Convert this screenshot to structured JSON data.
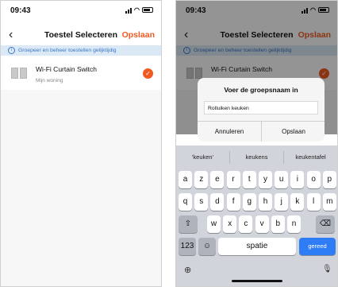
{
  "status": {
    "time": "09:43"
  },
  "nav": {
    "back_icon": "‹",
    "title": "Toestel Selecteren",
    "save_label": "Opslaan"
  },
  "info_banner": {
    "icon": "info-icon",
    "text": "Groepeer en beheer toestellen gelijktijdig"
  },
  "device": {
    "name": "Wi-Fi Curtain Switch",
    "location": "Mijn woning",
    "selected": true,
    "check": "✓"
  },
  "dialog": {
    "title": "Voer de groepsnaam in",
    "input_value": "Rolluiken keuken",
    "cancel_label": "Annuleren",
    "save_label": "Opslaan"
  },
  "keyboard": {
    "suggestions": [
      "'keuken'",
      "keukens",
      "keukentafel"
    ],
    "row1": [
      "a",
      "z",
      "e",
      "r",
      "t",
      "y",
      "u",
      "i",
      "o",
      "p"
    ],
    "row2": [
      "q",
      "s",
      "d",
      "f",
      "g",
      "h",
      "j",
      "k",
      "l",
      "m"
    ],
    "row3": [
      "w",
      "x",
      "c",
      "v",
      "b",
      "n"
    ],
    "shift_icon": "⇧",
    "backspace_icon": "⌫",
    "numbers_label": "123",
    "emoji_icon": "☺",
    "space_label": "spatie",
    "return_label": "gereed",
    "globe_icon": "⊕",
    "mic_icon": "🎙"
  },
  "colors": {
    "accent": "#f05a22",
    "info_bg": "#dbe9f7",
    "return_key": "#2f7df6"
  }
}
